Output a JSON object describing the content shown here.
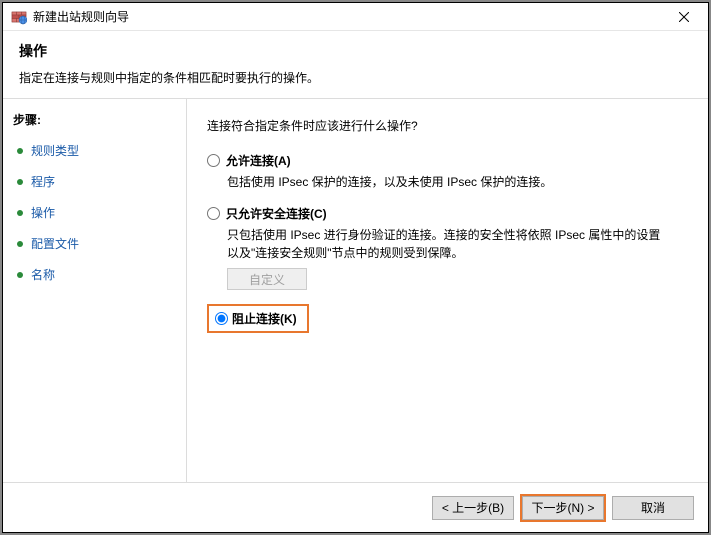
{
  "window": {
    "title": "新建出站规则向导"
  },
  "header": {
    "title": "操作",
    "subtitle": "指定在连接与规则中指定的条件相匹配时要执行的操作。"
  },
  "sidebar": {
    "steps_label": "步骤:",
    "items": [
      {
        "label": "规则类型"
      },
      {
        "label": "程序"
      },
      {
        "label": "操作"
      },
      {
        "label": "配置文件"
      },
      {
        "label": "名称"
      }
    ]
  },
  "content": {
    "prompt": "连接符合指定条件时应该进行什么操作?",
    "options": {
      "allow": {
        "label": "允许连接(A)",
        "desc": "包括使用 IPsec 保护的连接，以及未使用 IPsec 保护的连接。"
      },
      "allow_secure": {
        "label": "只允许安全连接(C)",
        "desc": "只包括使用 IPsec 进行身份验证的连接。连接的安全性将依照 IPsec 属性中的设置以及\"连接安全规则\"节点中的规则受到保障。",
        "custom_btn": "自定义"
      },
      "block": {
        "label": "阻止连接(K)"
      }
    }
  },
  "footer": {
    "back": "< 上一步(B)",
    "next": "下一步(N) >",
    "cancel": "取消"
  }
}
